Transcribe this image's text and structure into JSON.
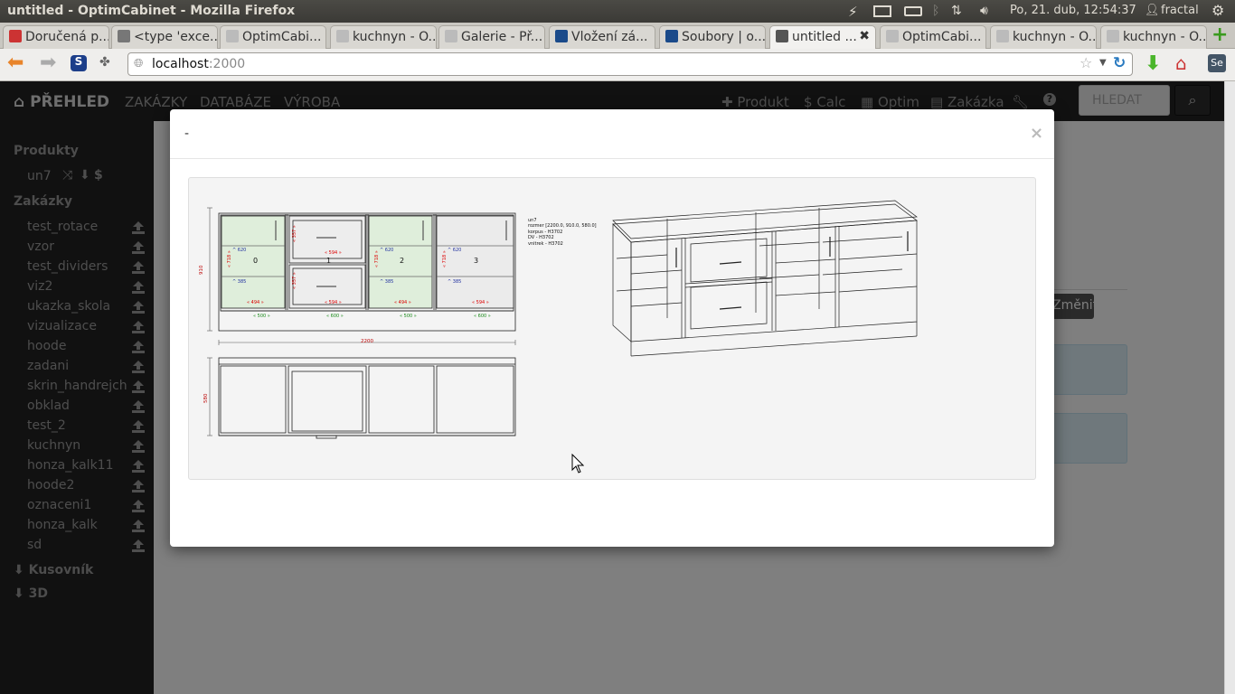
{
  "os": {
    "window_title": "untitled - OptimCabinet - Mozilla Firefox",
    "datetime": "Po, 21. dub, 12:54:37",
    "user": "fractal"
  },
  "tabs": [
    {
      "label": "Doručená p...",
      "fav_color": "#c33"
    },
    {
      "label": "<type 'exce...",
      "fav_color": "#777"
    },
    {
      "label": "OptimCabi...",
      "fav_color": "#bbb"
    },
    {
      "label": "kuchnyn - O...",
      "fav_color": "#bbb"
    },
    {
      "label": "Galerie - Př...",
      "fav_color": "#bbb"
    },
    {
      "label": "Vložení zá...",
      "fav_color": "#1a4a8a"
    },
    {
      "label": "Soubory | o...",
      "fav_color": "#1a4a8a"
    },
    {
      "label": "untitled ...",
      "fav_color": "#555",
      "active": true
    },
    {
      "label": "OptimCabi...",
      "fav_color": "#bbb"
    },
    {
      "label": "kuchnyn - O...",
      "fav_color": "#bbb"
    },
    {
      "label": "kuchnyn - O...",
      "fav_color": "#bbb"
    }
  ],
  "browser": {
    "url_host": "localhost",
    "url_port": ":2000"
  },
  "navbar": {
    "brand": "PŘEHLED",
    "menu": [
      "ZAKÁZKY",
      "DATABÁZE",
      "VÝROBA"
    ],
    "actions": [
      "Produkt",
      "Calc",
      "Optim",
      "Zakázka"
    ],
    "search_placeholder": "HLEDAT"
  },
  "sidebar": {
    "products_heading": "Produkty",
    "product_item": "un7",
    "orders_heading": "Zakázky",
    "orders": [
      "test_rotace",
      "vzor",
      "test_dividers",
      "viz2",
      "ukazka_skola",
      "vizualizace",
      "hoode",
      "zadani",
      "skrin_handrejch",
      "obklad",
      "test_2",
      "kuchnyn",
      "honza_kalk11",
      "hoode2",
      "oznaceni1",
      "honza_kalk",
      "sd"
    ],
    "kusovnik": "Kusovník",
    "three_d": "3D"
  },
  "background": {
    "change_button": "Změnit"
  },
  "modal": {
    "title": "-",
    "close": "×"
  },
  "drawing": {
    "spec_lines": [
      "un7",
      "rozmer [2200.0, 910.0, 580.0]",
      "korpus - H3702",
      "DV - H3702",
      "vnitrek - H3702"
    ],
    "total_width": "2200",
    "height": "910",
    "depth": "580",
    "bays": [
      {
        "num": "0",
        "width": "500",
        "inner_w": "494",
        "inner_h": "718",
        "depth": "620",
        "depth2": "385"
      },
      {
        "num": "1",
        "width": "600",
        "inner_w": "594",
        "inner_h": "357",
        "depth": "",
        "depth2": ""
      },
      {
        "num": "2",
        "width": "500",
        "inner_w": "494",
        "inner_h": "718",
        "depth": "620",
        "depth2": "385"
      },
      {
        "num": "3",
        "width": "600",
        "inner_w": "594",
        "inner_h": "718",
        "depth": "620",
        "depth2": "385"
      }
    ]
  }
}
